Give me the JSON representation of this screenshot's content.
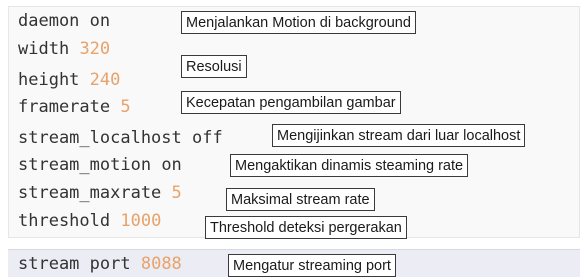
{
  "config_lines": [
    {
      "key": "daemon",
      "value": "on"
    },
    {
      "key": "width",
      "value": "320"
    },
    {
      "key": "height",
      "value": "240"
    },
    {
      "key": "framerate",
      "value": "5"
    },
    {
      "key": "stream_localhost",
      "value": "off"
    },
    {
      "key": "stream_motion",
      "value": "on"
    },
    {
      "key": "stream_maxrate",
      "value": "5"
    },
    {
      "key": "threshold",
      "value": "1000"
    },
    {
      "key": "stream port",
      "value": "8088"
    }
  ],
  "annotations": {
    "daemon": "Menjalankan Motion di background",
    "resolution": "Resolusi",
    "framerate": "Kecepatan pengambilan gambar",
    "stream_localhost": "Mengijinkan stream dari luar localhost",
    "stream_motion": "Mengaktikan dinamis steaming rate",
    "stream_maxrate": "Maksimal stream rate",
    "threshold": "Threshold deteksi pergerakan",
    "stream_port": "Mengatur streaming port"
  },
  "colors": {
    "text": "#333333",
    "number": "#e8a26a",
    "panel_bg": "#f9f9f9",
    "note_border": "#3a3a3a"
  }
}
